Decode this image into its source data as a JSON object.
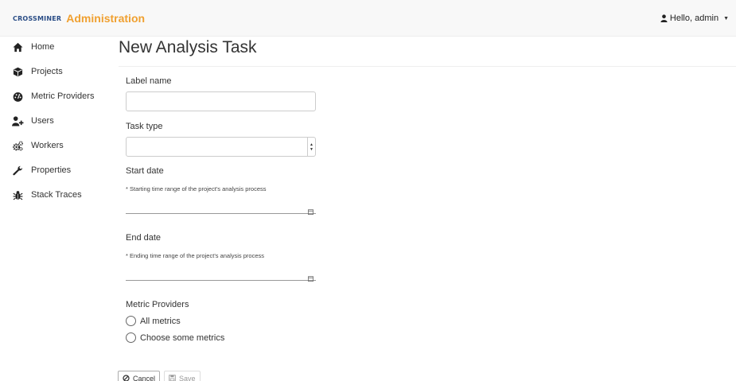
{
  "navbar": {
    "logo_text": "CROSSMINER",
    "title": "Administration",
    "user_greeting": "Hello, admin",
    "user_icon": "user-icon",
    "caret_icon": "caret-down-icon"
  },
  "sidebar": {
    "items": [
      {
        "label": "Home",
        "icon": "home-icon"
      },
      {
        "label": "Projects",
        "icon": "cube-icon"
      },
      {
        "label": "Metric Providers",
        "icon": "dashboard-icon"
      },
      {
        "label": "Users",
        "icon": "user-plus-icon"
      },
      {
        "label": "Workers",
        "icon": "cogs-icon"
      },
      {
        "label": "Properties",
        "icon": "wrench-icon"
      },
      {
        "label": "Stack Traces",
        "icon": "bug-icon"
      }
    ]
  },
  "main": {
    "title": "New Analysis Task",
    "form": {
      "label_name": {
        "label": "Label name",
        "value": "",
        "placeholder": ""
      },
      "task_type": {
        "label": "Task type",
        "selected": ""
      },
      "start_date": {
        "label": "Start date",
        "hint": "* Starting time range of the project's analysis process",
        "value": ""
      },
      "end_date": {
        "label": "End date",
        "hint": "* Ending time range of the project's analysis process",
        "value": ""
      },
      "metric_providers": {
        "label": "Metric Providers",
        "options": [
          {
            "label": "All metrics",
            "selected": false
          },
          {
            "label": "Choose some metrics",
            "selected": false
          }
        ]
      }
    },
    "buttons": {
      "cancel_label": "Cancel",
      "save_label": "Save",
      "save_enabled": false
    }
  },
  "colors": {
    "brand_blue": "#2a4d86",
    "brand_orange": "#f0a030",
    "navbar_bg": "#f8f8f8",
    "text": "#333333"
  }
}
